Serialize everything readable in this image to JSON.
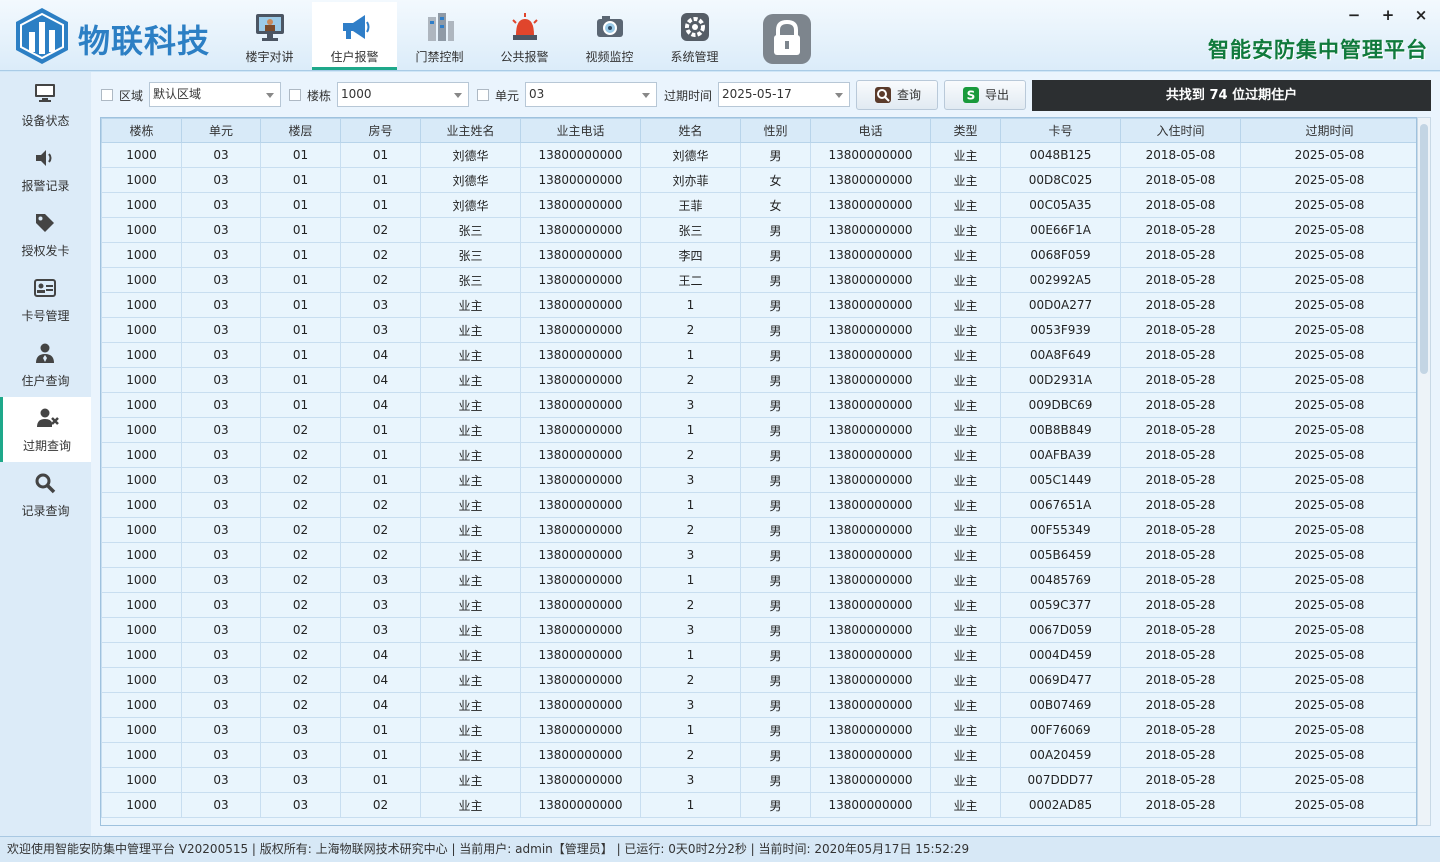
{
  "app": {
    "logo_text": "物联科技",
    "platform_title": "智能安防集中管理平台"
  },
  "nav": [
    {
      "label": "楼宇对讲",
      "icon": "monitor-intercom-icon"
    },
    {
      "label": "住户报警",
      "icon": "megaphone-icon"
    },
    {
      "label": "门禁控制",
      "icon": "access-control-icon"
    },
    {
      "label": "公共报警",
      "icon": "alarm-light-icon"
    },
    {
      "label": "视频监控",
      "icon": "camera-icon"
    },
    {
      "label": "系统管理",
      "icon": "gear-icon"
    }
  ],
  "nav_active": "住户报警",
  "window_controls": {
    "minimize": "−",
    "maximize": "+",
    "close": "×"
  },
  "sidebar": [
    {
      "label": "设备状态",
      "icon": "monitor-icon"
    },
    {
      "label": "报警记录",
      "icon": "speaker-icon"
    },
    {
      "label": "授权发卡",
      "icon": "tags-icon"
    },
    {
      "label": "卡号管理",
      "icon": "id-card-icon"
    },
    {
      "label": "住户查询",
      "icon": "user-tie-icon"
    },
    {
      "label": "过期查询",
      "icon": "user-times-icon"
    },
    {
      "label": "记录查询",
      "icon": "search-icon"
    }
  ],
  "sidebar_active": "过期查询",
  "filters": {
    "area_label": "区域",
    "area_value": "默认区域",
    "building_label": "楼栋",
    "building_value": "1000",
    "unit_label": "单元",
    "unit_value": "03",
    "expire_label": "过期时间",
    "expire_value": "2025-05-17",
    "query_button": "查询",
    "export_button": "导出"
  },
  "result_text": "共找到 74 位过期住户",
  "table": {
    "columns": [
      "楼栋",
      "单元",
      "楼层",
      "房号",
      "业主姓名",
      "业主电话",
      "姓名",
      "性别",
      "电话",
      "类型",
      "卡号",
      "入住时间",
      "过期时间"
    ],
    "rows": [
      [
        "1000",
        "03",
        "01",
        "01",
        "刘德华",
        "13800000000",
        "刘德华",
        "男",
        "13800000000",
        "业主",
        "0048B125",
        "2018-05-08",
        "2025-05-08"
      ],
      [
        "1000",
        "03",
        "01",
        "01",
        "刘德华",
        "13800000000",
        "刘亦菲",
        "女",
        "13800000000",
        "业主",
        "00D8C025",
        "2018-05-08",
        "2025-05-08"
      ],
      [
        "1000",
        "03",
        "01",
        "01",
        "刘德华",
        "13800000000",
        "王菲",
        "女",
        "13800000000",
        "业主",
        "00C05A35",
        "2018-05-08",
        "2025-05-08"
      ],
      [
        "1000",
        "03",
        "01",
        "02",
        "张三",
        "13800000000",
        "张三",
        "男",
        "13800000000",
        "业主",
        "00E66F1A",
        "2018-05-28",
        "2025-05-08"
      ],
      [
        "1000",
        "03",
        "01",
        "02",
        "张三",
        "13800000000",
        "李四",
        "男",
        "13800000000",
        "业主",
        "0068F059",
        "2018-05-28",
        "2025-05-08"
      ],
      [
        "1000",
        "03",
        "01",
        "02",
        "张三",
        "13800000000",
        "王二",
        "男",
        "13800000000",
        "业主",
        "002992A5",
        "2018-05-28",
        "2025-05-08"
      ],
      [
        "1000",
        "03",
        "01",
        "03",
        "业主",
        "13800000000",
        "1",
        "男",
        "13800000000",
        "业主",
        "00D0A277",
        "2018-05-28",
        "2025-05-08"
      ],
      [
        "1000",
        "03",
        "01",
        "03",
        "业主",
        "13800000000",
        "2",
        "男",
        "13800000000",
        "业主",
        "0053F939",
        "2018-05-28",
        "2025-05-08"
      ],
      [
        "1000",
        "03",
        "01",
        "04",
        "业主",
        "13800000000",
        "1",
        "男",
        "13800000000",
        "业主",
        "00A8F649",
        "2018-05-28",
        "2025-05-08"
      ],
      [
        "1000",
        "03",
        "01",
        "04",
        "业主",
        "13800000000",
        "2",
        "男",
        "13800000000",
        "业主",
        "00D2931A",
        "2018-05-28",
        "2025-05-08"
      ],
      [
        "1000",
        "03",
        "01",
        "04",
        "业主",
        "13800000000",
        "3",
        "男",
        "13800000000",
        "业主",
        "009DBC69",
        "2018-05-28",
        "2025-05-08"
      ],
      [
        "1000",
        "03",
        "02",
        "01",
        "业主",
        "13800000000",
        "1",
        "男",
        "13800000000",
        "业主",
        "00B8B849",
        "2018-05-28",
        "2025-05-08"
      ],
      [
        "1000",
        "03",
        "02",
        "01",
        "业主",
        "13800000000",
        "2",
        "男",
        "13800000000",
        "业主",
        "00AFBA39",
        "2018-05-28",
        "2025-05-08"
      ],
      [
        "1000",
        "03",
        "02",
        "01",
        "业主",
        "13800000000",
        "3",
        "男",
        "13800000000",
        "业主",
        "005C1449",
        "2018-05-28",
        "2025-05-08"
      ],
      [
        "1000",
        "03",
        "02",
        "02",
        "业主",
        "13800000000",
        "1",
        "男",
        "13800000000",
        "业主",
        "0067651A",
        "2018-05-28",
        "2025-05-08"
      ],
      [
        "1000",
        "03",
        "02",
        "02",
        "业主",
        "13800000000",
        "2",
        "男",
        "13800000000",
        "业主",
        "00F55349",
        "2018-05-28",
        "2025-05-08"
      ],
      [
        "1000",
        "03",
        "02",
        "02",
        "业主",
        "13800000000",
        "3",
        "男",
        "13800000000",
        "业主",
        "005B6459",
        "2018-05-28",
        "2025-05-08"
      ],
      [
        "1000",
        "03",
        "02",
        "03",
        "业主",
        "13800000000",
        "1",
        "男",
        "13800000000",
        "业主",
        "00485769",
        "2018-05-28",
        "2025-05-08"
      ],
      [
        "1000",
        "03",
        "02",
        "03",
        "业主",
        "13800000000",
        "2",
        "男",
        "13800000000",
        "业主",
        "0059C377",
        "2018-05-28",
        "2025-05-08"
      ],
      [
        "1000",
        "03",
        "02",
        "03",
        "业主",
        "13800000000",
        "3",
        "男",
        "13800000000",
        "业主",
        "0067D059",
        "2018-05-28",
        "2025-05-08"
      ],
      [
        "1000",
        "03",
        "02",
        "04",
        "业主",
        "13800000000",
        "1",
        "男",
        "13800000000",
        "业主",
        "0004D459",
        "2018-05-28",
        "2025-05-08"
      ],
      [
        "1000",
        "03",
        "02",
        "04",
        "业主",
        "13800000000",
        "2",
        "男",
        "13800000000",
        "业主",
        "0069D477",
        "2018-05-28",
        "2025-05-08"
      ],
      [
        "1000",
        "03",
        "02",
        "04",
        "业主",
        "13800000000",
        "3",
        "男",
        "13800000000",
        "业主",
        "00B07469",
        "2018-05-28",
        "2025-05-08"
      ],
      [
        "1000",
        "03",
        "03",
        "01",
        "业主",
        "13800000000",
        "1",
        "男",
        "13800000000",
        "业主",
        "00F76069",
        "2018-05-28",
        "2025-05-08"
      ],
      [
        "1000",
        "03",
        "03",
        "01",
        "业主",
        "13800000000",
        "2",
        "男",
        "13800000000",
        "业主",
        "00A20459",
        "2018-05-28",
        "2025-05-08"
      ],
      [
        "1000",
        "03",
        "03",
        "01",
        "业主",
        "13800000000",
        "3",
        "男",
        "13800000000",
        "业主",
        "007DDD77",
        "2018-05-28",
        "2025-05-08"
      ],
      [
        "1000",
        "03",
        "03",
        "02",
        "业主",
        "13800000000",
        "1",
        "男",
        "13800000000",
        "业主",
        "0002AD85",
        "2018-05-28",
        "2025-05-08"
      ]
    ]
  },
  "status_bar": "欢迎使用智能安防集中管理平台 V20200515 | 版权所有: 上海物联网技术研究中心 | 当前用户: admin【管理员】 | 已运行: 0天0时2分2秒 | 当前时间: 2020年05月17日 15:52:29"
}
